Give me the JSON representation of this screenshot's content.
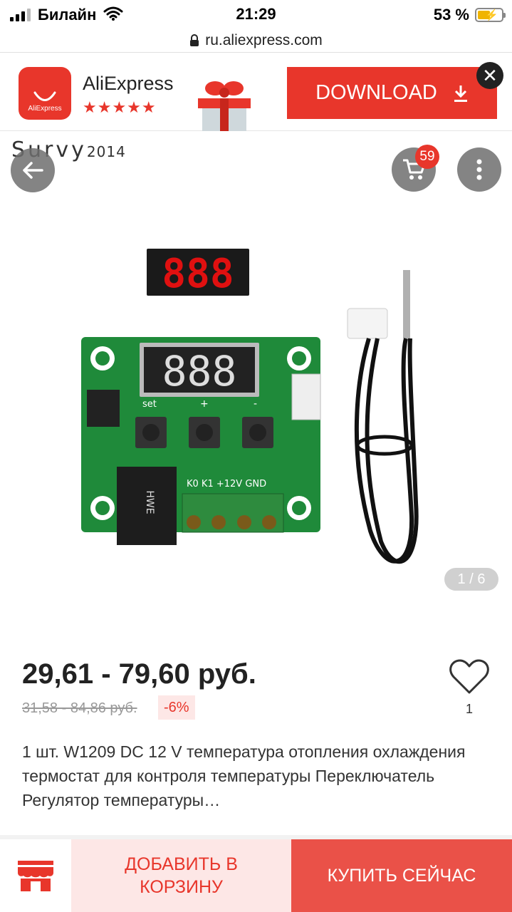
{
  "status_bar": {
    "carrier": "Билайн",
    "time": "21:29",
    "battery_pct": "53 %",
    "battery_level": 0.53,
    "icons": [
      "signal-icon",
      "wifi-icon",
      "battery-charging-icon"
    ]
  },
  "browser": {
    "url": "ru.aliexpress.com"
  },
  "app_banner": {
    "logo_text": "AliExpress",
    "app_name": "AliExpress",
    "rating_stars": "★★★★★",
    "download_label": "DOWNLOAD",
    "close_symbol": "✕",
    "accent_color": "#e8362b"
  },
  "gallery": {
    "watermark_brand": "Survy",
    "watermark_year": "2014",
    "cart_badge": "59",
    "image_counter": "1 / 6",
    "display_digits": "888",
    "board_labels": {
      "set": "set",
      "plus": "+",
      "minus": "-",
      "terminals": "K0  K1 +12V GND",
      "relay_brand": "HWE"
    }
  },
  "product": {
    "price": "29,61 - 79,60 руб.",
    "old_price": "31,58 - 84,86 руб.",
    "discount": "-6%",
    "wishlist_count": "1",
    "title": "1 шт. W1209 DC 12 V температура отопления охлаждения термостат для контроля температуры Переключатель Регулятор температуры…"
  },
  "bottom_bar": {
    "add_to_cart_label": "ДОБАВИТЬ В КОРЗИНУ",
    "buy_now_label": "КУПИТЬ СЕЙЧАС"
  }
}
